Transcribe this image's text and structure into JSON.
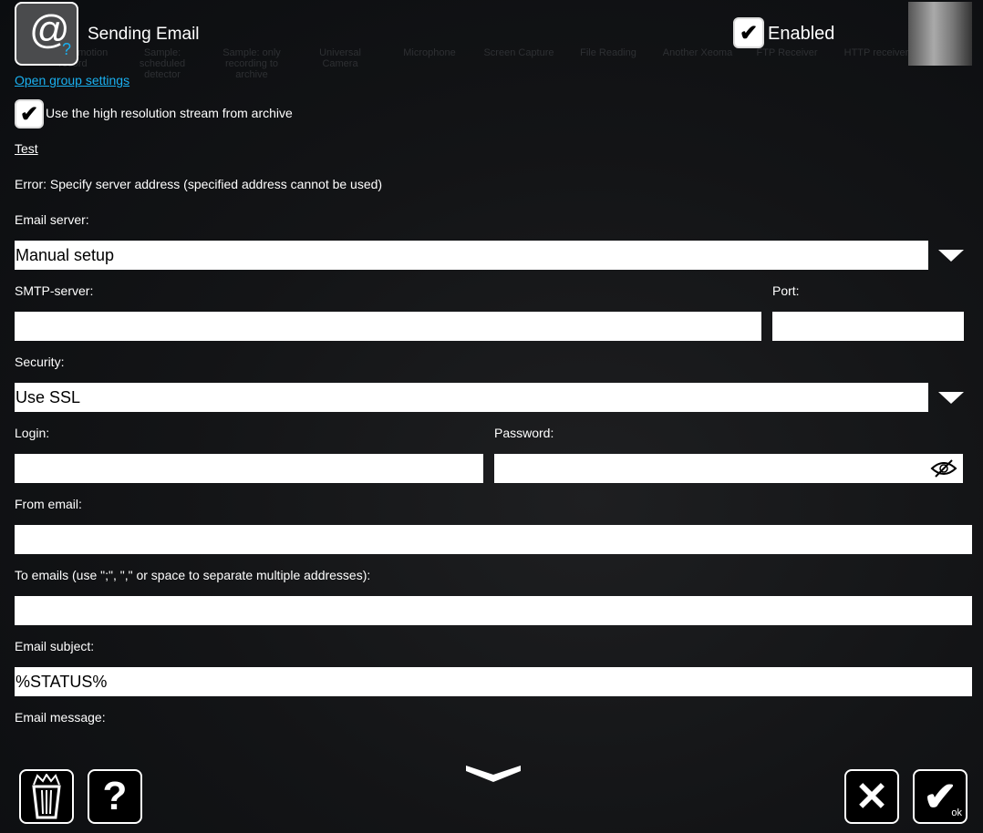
{
  "background_modules": [
    "Sample: motion record",
    "Sample: scheduled detector",
    "Sample: only recording to archive",
    "Universal Camera",
    "Microphone",
    "Screen Capture",
    "File Reading",
    "Another Xeoma",
    "FTP Receiver",
    "HTTP receiver"
  ],
  "header": {
    "title": "Sending Email",
    "enabled_label": "Enabled",
    "enabled": true,
    "group_settings_link": "Open group settings"
  },
  "form": {
    "high_res_label": "Use the high resolution stream from archive",
    "high_res_checked": true,
    "test_link": "Test",
    "error": "Error: Specify server address (specified address cannot be used)",
    "email_server_label": "Email server:",
    "email_server_value": "Manual setup",
    "smtp_label": "SMTP-server:",
    "smtp_value": "",
    "port_label": "Port:",
    "port_value": "",
    "security_label": "Security:",
    "security_value": "Use SSL",
    "login_label": "Login:",
    "login_value": "",
    "password_label": "Password:",
    "password_value": "",
    "from_label": "From email:",
    "from_value": "",
    "to_label": "To emails (use \";\", \",\" or space to separate multiple addresses):",
    "to_value": "",
    "subject_label": "Email subject:",
    "subject_value": "%STATUS%",
    "message_label": "Email message:"
  },
  "footer": {
    "ok_label": "ok"
  },
  "colors": {
    "link": "#1ab0f0",
    "background": "#0b0d10"
  }
}
